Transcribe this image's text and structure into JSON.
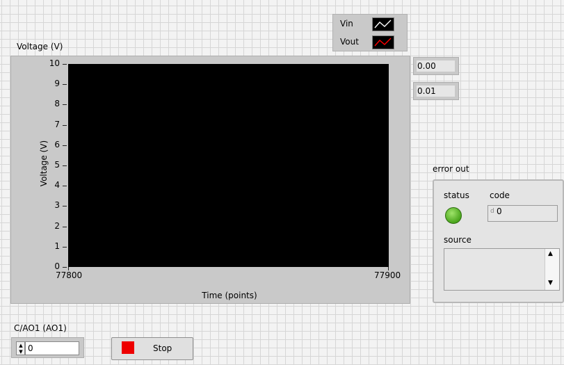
{
  "legend": {
    "items": [
      {
        "label": "Vin",
        "color": "#ffffff"
      },
      {
        "label": "Vout",
        "color": "#ff0000"
      }
    ]
  },
  "graph": {
    "title": "Voltage (V)"
  },
  "chart_data": {
    "type": "line",
    "ylabel": "Voltage (V)",
    "xlabel": "Time (points)",
    "ylim": [
      0,
      10
    ],
    "xlim": [
      77800,
      77900
    ],
    "yticks": [
      "10",
      "9",
      "8",
      "7",
      "6",
      "5",
      "4",
      "3",
      "2",
      "1",
      "0"
    ],
    "xticks": [
      "77800",
      "77900"
    ],
    "series": [
      {
        "name": "Vin",
        "values": []
      },
      {
        "name": "Vout",
        "values": []
      }
    ],
    "background": "#000000"
  },
  "indicators": {
    "vin_value": "0.00",
    "vout_value": "0.01"
  },
  "error_out": {
    "title": "error out",
    "status_label": "status",
    "code_label": "code",
    "code_radix": "d",
    "code_value": "0",
    "source_label": "source",
    "source_value": "",
    "status_color": "#4aa51c"
  },
  "control": {
    "label": "C/AO1 (AO1)",
    "value": "0"
  },
  "stop_button": {
    "label": "Stop",
    "color": "#ee0000"
  }
}
